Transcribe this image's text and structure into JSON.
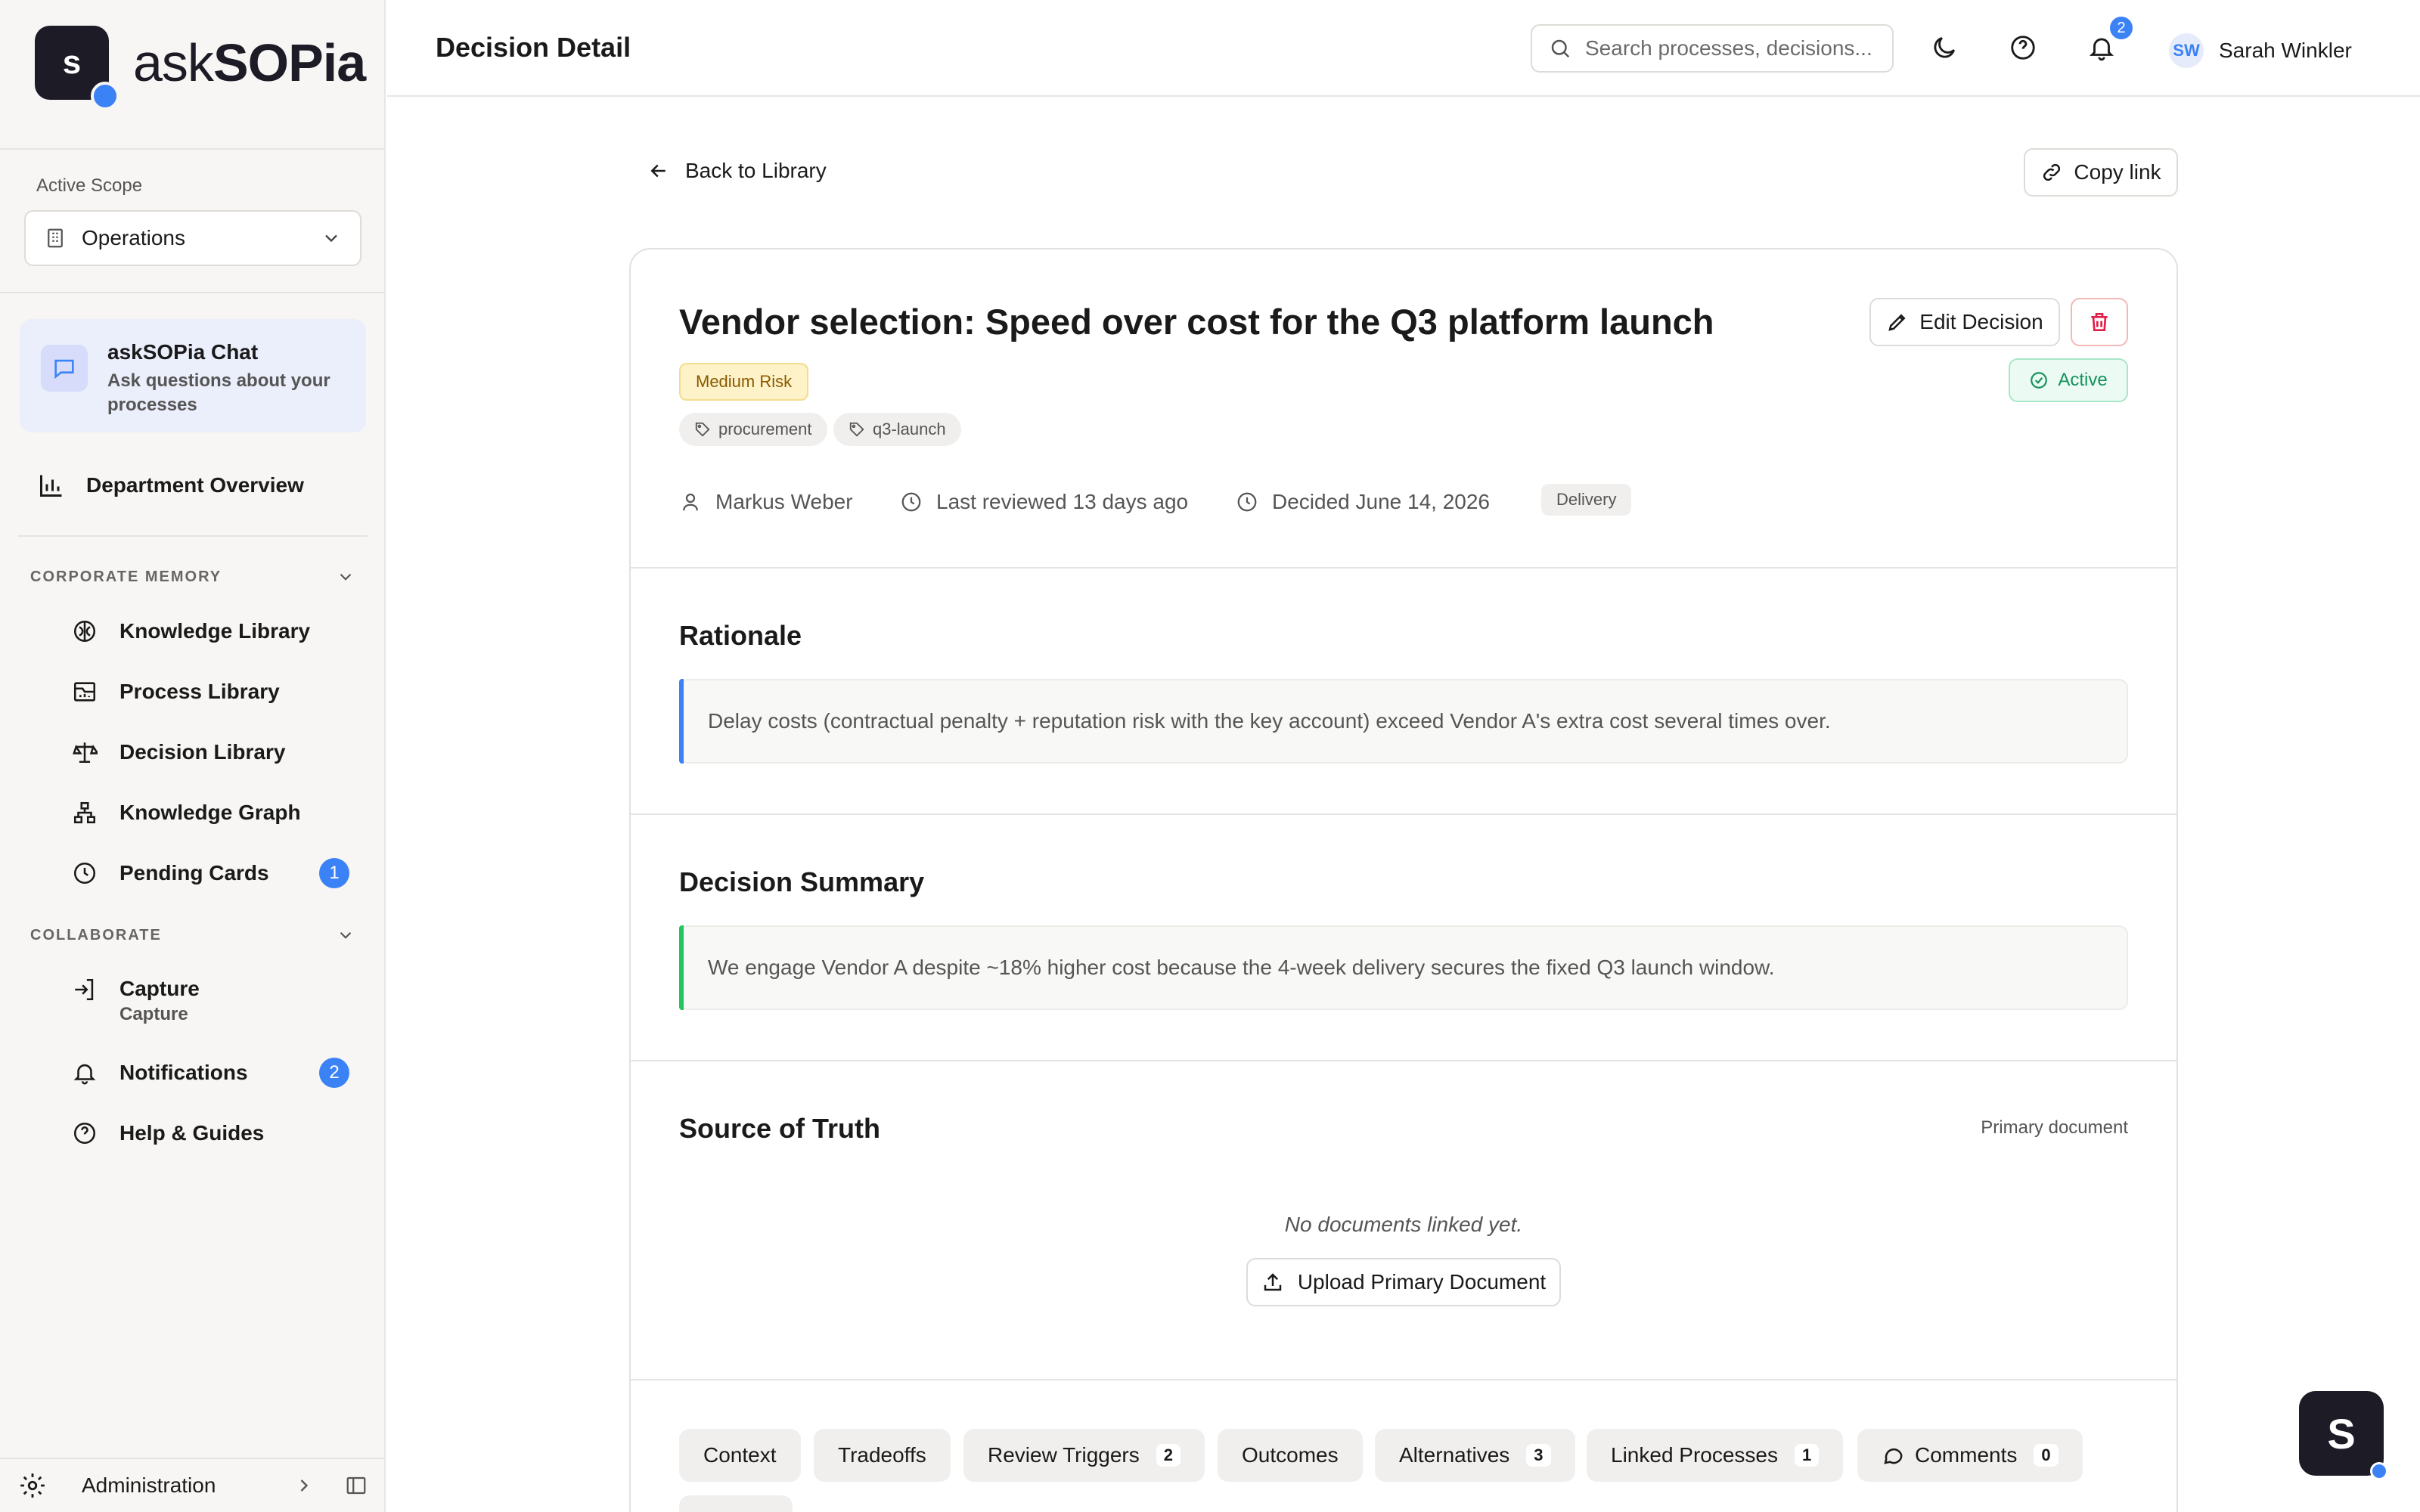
{
  "app": {
    "logo_letter": "s",
    "name_plain": "ask",
    "name_bold": "SOPia"
  },
  "sidebar": {
    "scope_label": "Active Scope",
    "scope_value": "Operations",
    "chat": {
      "title": "askSOPia Chat",
      "subtitle_line1": "Ask questions about your",
      "subtitle_line2": "processes"
    },
    "department_overview": "Department Overview",
    "corporate_memory": {
      "heading": "CORPORATE MEMORY",
      "items": [
        {
          "label": "Knowledge Library",
          "icon": "brain-icon"
        },
        {
          "label": "Process Library",
          "icon": "process-icon"
        },
        {
          "label": "Decision Library",
          "icon": "scale-icon"
        },
        {
          "label": "Knowledge Graph",
          "icon": "graph-icon"
        },
        {
          "label": "Pending Cards",
          "icon": "clock-icon",
          "badge": "1"
        }
      ]
    },
    "collaborate": {
      "heading": "COLLABORATE",
      "items": [
        {
          "label": "Capture",
          "sublabel": "Capture",
          "icon": "capture-icon"
        },
        {
          "label": "Notifications",
          "icon": "bell-icon",
          "badge": "2"
        },
        {
          "label": "Help & Guides",
          "icon": "help-icon"
        }
      ]
    },
    "administration": "Administration"
  },
  "topbar": {
    "title": "Decision Detail",
    "search_placeholder": "Search processes, decisions...",
    "notification_count": "2",
    "user": {
      "initials": "SW",
      "name": "Sarah Winkler"
    }
  },
  "main": {
    "back_label": "Back to Library",
    "copy_link_label": "Copy link",
    "decision": {
      "title": "Vendor selection: Speed over cost for the Q3 platform launch",
      "risk": "Medium Risk",
      "tags": [
        "procurement",
        "q3-launch"
      ],
      "status": "Active",
      "edit_label": "Edit Decision",
      "owner": "Markus Weber",
      "last_reviewed": "Last reviewed 13 days ago",
      "decided": "Decided June 14, 2026",
      "department": "Delivery"
    },
    "rationale": {
      "title": "Rationale",
      "text": "Delay costs (contractual penalty + reputation risk with the key account) exceed Vendor A's extra cost several times over."
    },
    "summary": {
      "title": "Decision Summary",
      "text": "We engage Vendor A despite ~18% higher cost because the 4-week delivery secures the fixed Q3 launch window."
    },
    "source_of_truth": {
      "title": "Source of Truth",
      "hint": "Primary document",
      "empty": "No documents linked yet.",
      "upload_label": "Upload Primary Document"
    },
    "tabs": [
      {
        "label": "Context"
      },
      {
        "label": "Tradeoffs"
      },
      {
        "label": "Review Triggers",
        "count": "2"
      },
      {
        "label": "Outcomes"
      },
      {
        "label": "Alternatives",
        "count": "3"
      },
      {
        "label": "Linked Processes",
        "count": "1"
      },
      {
        "label": "Comments",
        "count": "0"
      }
    ]
  },
  "fab_letter": "S",
  "colors": {
    "accent": "#3b82f6",
    "brand_dark": "#1c1b26",
    "rationale_bar": "#3b82f6",
    "summary_bar": "#22c55e",
    "danger": "#e11d48"
  }
}
